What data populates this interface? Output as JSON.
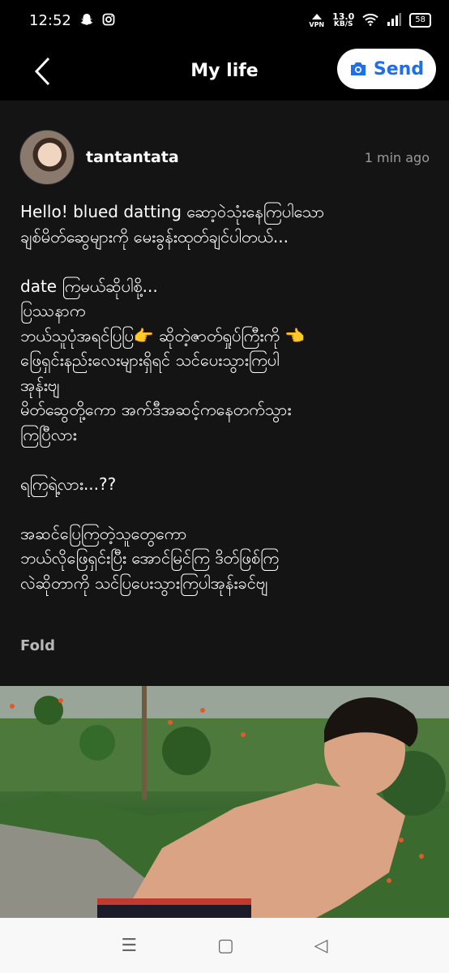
{
  "status_bar": {
    "time": "12:52",
    "net_speed_value": "13.0",
    "net_speed_unit": "KB/S",
    "vpn_label": "VPN",
    "battery": "58"
  },
  "header": {
    "title": "My life",
    "send_label": "Send"
  },
  "post": {
    "username": "tantantata",
    "time": "1 min ago",
    "lines": [
      "Hello! blued datting ဆော့ဝဲသုံးနေကြပါသော",
      "ချစ်မိတ်ဆွေများကို မေးခွန်းထုတ်ချင်ပါတယ်...",
      "",
      "date ကြမယ်ဆိုပါစို့...",
      "ပြဿနာက",
      "ဘယ်သူပုံအရင်ပြပြ👉 ဆိုတဲ့ဇာတ်ရှုပ်ကြီးကို 👈",
      "ဖြေရှင်းနည်းလေးများရှိရင် သင်ပေးသွားကြပါ",
      "အုန်းဗျ",
      "မိတ်ဆွေတို့ကော အက်ဒီအဆင့်ကနေတက်သွား",
      "ကြပြီလား",
      "",
      "ရကြရဲ့လား...??",
      "",
      "အဆင်ပြေကြတဲ့သူတွေကော",
      "ဘယ်လိုဖြေရှင်းပြီး အောင်မြင်ကြ ဒိတ်ဖြစ်ကြ",
      "လဲဆိုတာကို သင်ပြပေးသွားကြပါအုန်းခင်ဗျ"
    ],
    "fold_label": "Fold"
  },
  "nav": {
    "recents_icon": "☰",
    "home_icon": "▢",
    "back_icon": "◁"
  }
}
